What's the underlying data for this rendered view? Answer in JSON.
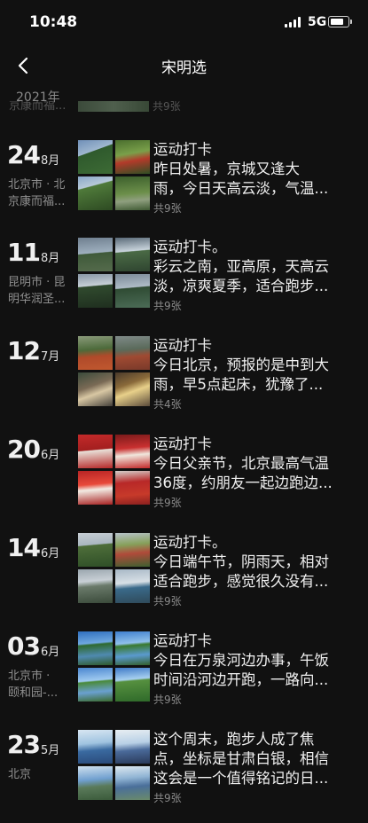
{
  "status_bar": {
    "time": "10:48",
    "network": "5G",
    "battery_level": 0.85
  },
  "nav": {
    "title": "宋明选"
  },
  "year": "2021年",
  "entries": [
    {
      "day": "24",
      "month": "8月",
      "location": [
        "北京市 · 北",
        "京康而福..."
      ],
      "text": [
        "运动打卡",
        "  昨日处暑，京城又逢大",
        "雨，今日天高云淡，气温..."
      ],
      "count": "共9张"
    },
    {
      "day": "11",
      "month": "8月",
      "location": [
        "昆明市 · 昆",
        "明华润圣..."
      ],
      "text": [
        "运动打卡。",
        "彩云之南，亚高原，天高云",
        "淡，凉爽夏季，适合跑步..."
      ],
      "count": "共9张"
    },
    {
      "day": "12",
      "month": "7月",
      "location": [],
      "text": [
        "运动打卡",
        "今日北京，预报的是中到大",
        "雨，早5点起床，犹豫了..."
      ],
      "count": "共4张"
    },
    {
      "day": "20",
      "month": "6月",
      "location": [],
      "text": [
        "运动打卡",
        "今日父亲节，北京最高气温",
        "36度，约朋友一起边跑边..."
      ],
      "count": "共9张"
    },
    {
      "day": "14",
      "month": "6月",
      "location": [],
      "text": [
        "运动打卡。",
        "今日端午节，阴雨天，相对",
        "适合跑步，感觉很久没有..."
      ],
      "count": "共9张"
    },
    {
      "day": "03",
      "month": "6月",
      "location": [
        "北京市 ·",
        "颐和园-..."
      ],
      "text": [
        "运动打卡",
        "今日在万泉河边办事，午饭",
        "时间沿河边开跑，一路向..."
      ],
      "count": "共9张"
    },
    {
      "day": "23",
      "month": "5月",
      "location": [
        "北京"
      ],
      "text": [
        "这个周末，跑步人成了焦",
        "点，坐标是甘肃白银，相信",
        "这会是一个值得铭记的日..."
      ],
      "count": "共9张"
    }
  ],
  "icons": {
    "back": "chevron-left-icon",
    "signal": "signal-bars-icon",
    "battery": "battery-icon"
  },
  "colors": {
    "background": "#111111",
    "text": "#f0f0f0",
    "muted": "#8a8a8a"
  }
}
